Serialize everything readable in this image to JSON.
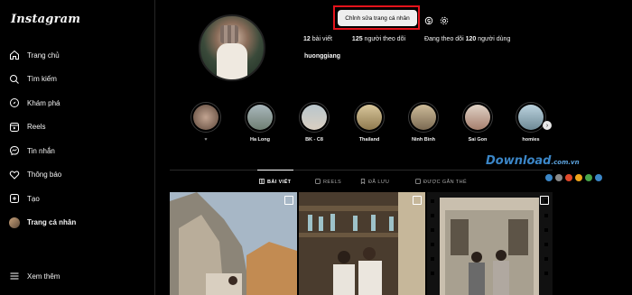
{
  "app": {
    "logo": "Instagram"
  },
  "sidebar": {
    "items": [
      {
        "label": "Trang chủ",
        "icon": "home-icon"
      },
      {
        "label": "Tìm kiếm",
        "icon": "search-icon"
      },
      {
        "label": "Khám phá",
        "icon": "compass-icon"
      },
      {
        "label": "Reels",
        "icon": "reels-icon"
      },
      {
        "label": "Tin nhắn",
        "icon": "messenger-icon"
      },
      {
        "label": "Thông báo",
        "icon": "heart-icon"
      },
      {
        "label": "Tạo",
        "icon": "plus-square-icon"
      },
      {
        "label": "Trang cá nhân",
        "icon": "avatar"
      }
    ],
    "more_label": "Xem thêm"
  },
  "profile": {
    "edit_label": "Chỉnh sửa trang cá nhân",
    "posts_num": "12",
    "posts_label": " bài viết",
    "followers_num": "125",
    "followers_label": " người theo dõi",
    "following_prefix": "Đang theo dõi ",
    "following_num": "120",
    "following_label": " người dùng",
    "username": "huonggiang"
  },
  "highlights": [
    {
      "label": "♥",
      "color": "#8b6a5a"
    },
    {
      "label": "Ha Long",
      "color": "#7a8f94"
    },
    {
      "label": "BK - C8",
      "color": "#8fa0a8"
    },
    {
      "label": "Thailand",
      "color": "#c9b38a"
    },
    {
      "label": "Ninh Bình",
      "color": "#a79373"
    },
    {
      "label": "Sai Gon",
      "color": "#d1b9a6"
    },
    {
      "label": "homies",
      "color": "#9cb8c9"
    }
  ],
  "tabs": {
    "posts": "BÀI VIẾT",
    "reels": "REELS",
    "saved": "ĐÃ LƯU",
    "tagged": "ĐƯỢC GẮN THẺ"
  },
  "watermark": {
    "main": "Download",
    "sub": ".com.vn"
  },
  "colors": {
    "highlight_box": "#e4131b",
    "accent_blue": "#3b86c7"
  }
}
